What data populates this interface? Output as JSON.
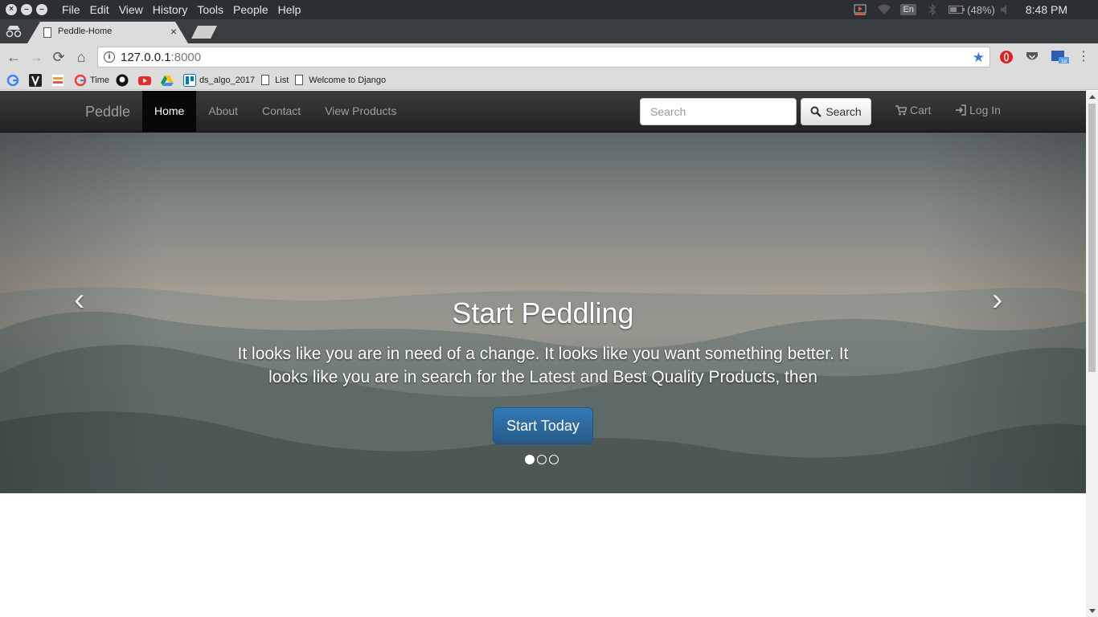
{
  "os": {
    "menu": [
      "File",
      "Edit",
      "View",
      "History",
      "Tools",
      "People",
      "Help"
    ],
    "keyboard_layout": "En",
    "battery": "(48%)",
    "clock": "8:48 PM",
    "icons": [
      "close-icon",
      "minimize-icon",
      "maximize-icon",
      "screencast-icon",
      "wifi-icon",
      "bluetooth-icon",
      "battery-icon",
      "volume-icon"
    ]
  },
  "browser": {
    "tab_title": "Peddle-Home",
    "tab_close": "×",
    "url_host": "127.0.0.1",
    "url_port": ":8000",
    "bookmarks": [
      {
        "label": "",
        "icon": "google-icon"
      },
      {
        "label": "",
        "icon": "bookmark-app-icon"
      },
      {
        "label": "",
        "icon": "backpack-icon"
      },
      {
        "label": "Time",
        "icon": "google-icon"
      },
      {
        "label": "",
        "icon": "github-icon"
      },
      {
        "label": "",
        "icon": "youtube-icon"
      },
      {
        "label": "",
        "icon": "google-drive-icon"
      },
      {
        "label": "ds_algo_2017",
        "icon": "trello-icon"
      },
      {
        "label": "List",
        "icon": "page-icon"
      },
      {
        "label": "Welcome to Django",
        "icon": "page-icon"
      }
    ],
    "colors": {
      "star": "#3a7bd5",
      "chrome": "#dcdcdc"
    }
  },
  "site": {
    "brand": "Peddle",
    "nav": [
      "Home",
      "About",
      "Contact",
      "View Products"
    ],
    "active_nav": "Home",
    "search_placeholder": "Search",
    "search_button": "Search",
    "cart": "Cart",
    "login": "Log In"
  },
  "carousel": {
    "heading": "Start Peddling",
    "text": "It looks like you are in need of a change. It looks like you want something better. It looks like you are in search for the Latest and Best Quality Products, then",
    "button": "Start Today",
    "slides": 3,
    "active_slide": 1,
    "colors": {
      "button": "#337ab7",
      "navbar": "#222222"
    }
  }
}
